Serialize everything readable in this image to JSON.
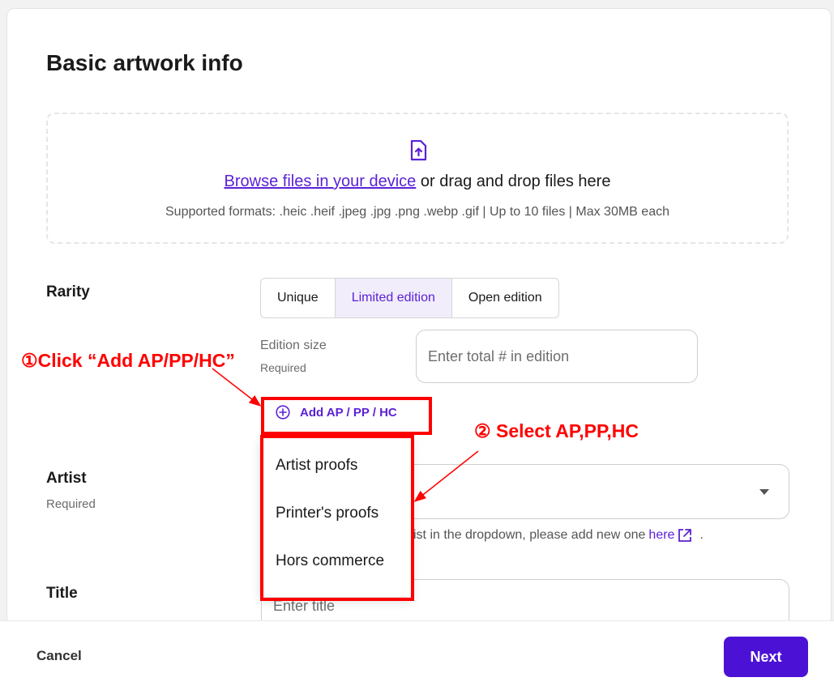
{
  "form": {
    "heading": "Basic artwork info",
    "upload": {
      "link_text": "Browse files in your device",
      "main_text": " or drag and drop files here",
      "formats_text": "Supported formats: .heic .heif .jpeg .jpg .png .webp .gif  |  Up to 10 files  |  Max 30MB each"
    },
    "rarity": {
      "label": "Rarity",
      "options": [
        "Unique",
        "Limited edition",
        "Open edition"
      ],
      "selected": "Limited edition"
    },
    "edition_size": {
      "label": "Edition size",
      "required": "Required",
      "placeholder": "Enter total # in edition"
    },
    "add_ap_label": "Add AP / PP / HC",
    "ap_options": [
      "Artist proofs",
      "Printer's proofs",
      "Hors commerce"
    ],
    "artist": {
      "label": "Artist",
      "required": "Required",
      "helper_text": "ist in the dropdown, please add new one",
      "helper_link": "here",
      "helper_end": "."
    },
    "title": {
      "label": "Title",
      "placeholder": "Enter title"
    }
  },
  "annotations": {
    "step1": "①Click “Add AP/PP/HC”",
    "step2": "② Select AP,PP,HC"
  },
  "footer": {
    "cancel_label": "Cancel",
    "next_label": "Next"
  },
  "colors": {
    "accent": "#5b21d6",
    "primary_button": "#4b12d6",
    "annotation": "#ff0000"
  }
}
